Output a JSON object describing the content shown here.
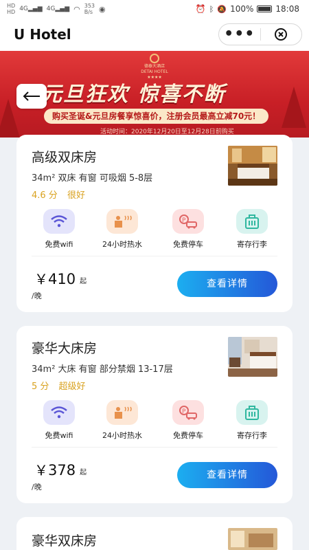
{
  "status_bar": {
    "sim_labels": [
      "HD",
      "HD"
    ],
    "network_1": "4G",
    "network_2": "4G",
    "speed_value": "353",
    "speed_unit": "B/s",
    "battery": "100%",
    "time": "18:08"
  },
  "header": {
    "title": "U Hotel"
  },
  "banner": {
    "hotel_name_cn": "德泰大酒店",
    "hotel_name_en": "DETAI HOTEL",
    "hotel_stars": "★★★★",
    "slogan": "元旦狂欢  惊喜不断",
    "promo": "购买圣诞&元旦房餐享惊喜价，注册会员最高立减70元！",
    "period": "活动时间：2020年12月20日至12月28日前购买",
    "colors": {
      "primary": "#c81f26",
      "accent": "#fbe8c8"
    }
  },
  "rooms": [
    {
      "name": "高级双床房",
      "desc": "34m² 双床 有窗 可吸烟 5-8层",
      "score": "4.6 分",
      "grade": "很好",
      "price": "410",
      "currency": "￥",
      "price_suffix": "起",
      "per": "/晚",
      "button": "查看详情"
    },
    {
      "name": "豪华大床房",
      "desc": "34m² 大床 有窗 部分禁烟 13-17层",
      "score": "5 分",
      "grade": "超级好",
      "price": "378",
      "currency": "￥",
      "price_suffix": "起",
      "per": "/晚",
      "button": "查看详情"
    },
    {
      "name": "豪华双床房"
    }
  ],
  "amenities": [
    {
      "label": "免费wifi",
      "icon": "wifi-icon",
      "color": "#e4e4fb",
      "fg": "#5a55d6"
    },
    {
      "label": "24小时热水",
      "icon": "hot-water-icon",
      "color": "#fde7d6",
      "fg": "#e8914c"
    },
    {
      "label": "免费停车",
      "icon": "parking-icon",
      "color": "#fde0e0",
      "fg": "#e06666"
    },
    {
      "label": "寄存行李",
      "icon": "luggage-icon",
      "color": "#d8f3ef",
      "fg": "#2fb79f"
    }
  ]
}
